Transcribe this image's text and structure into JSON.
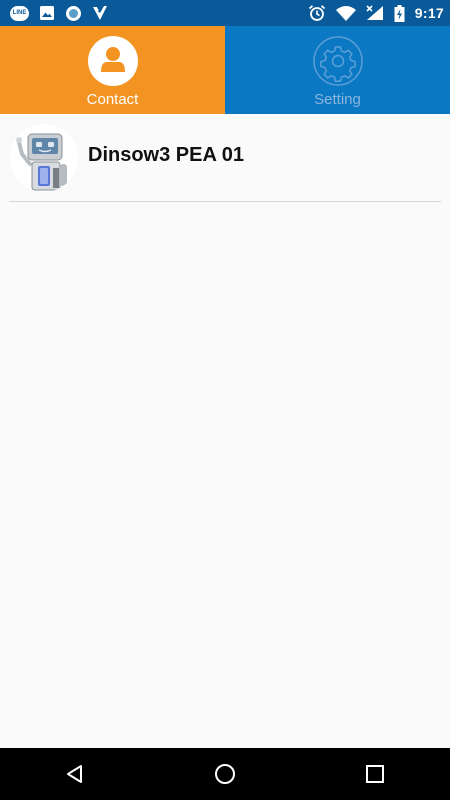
{
  "status_bar": {
    "time": "9:17",
    "left_icons": [
      "line-icon",
      "image-icon",
      "circle-app-icon",
      "checkmark-app-icon"
    ],
    "right_icons": [
      "alarm-icon",
      "wifi-icon",
      "signal-icon",
      "battery-charging-icon"
    ],
    "line_text": "LINE"
  },
  "tabs": [
    {
      "label": "Contact",
      "icon": "person-icon",
      "selected": true,
      "color": "#f39321"
    },
    {
      "label": "Setting",
      "icon": "gear-icon",
      "selected": false,
      "color": "#0b78c4"
    }
  ],
  "contacts": [
    {
      "name": "Dinsow3 PEA 01",
      "avatar": "robot-avatar"
    }
  ],
  "nav_bar": {
    "buttons": [
      "back-button",
      "home-button",
      "recents-button"
    ]
  },
  "colors": {
    "status_bar": "#0a5a99",
    "contact_tab": "#f39321",
    "setting_tab": "#0b78c4",
    "background": "#fafafa"
  }
}
